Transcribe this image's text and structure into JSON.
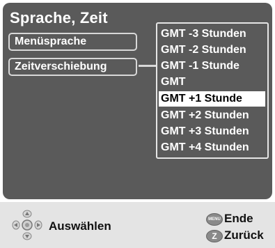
{
  "screen": {
    "title": "Sprache, Zeit",
    "menu": [
      {
        "label": "Menüsprache"
      },
      {
        "label": "Zeitverschiebung"
      }
    ]
  },
  "dropdown": {
    "options": [
      {
        "label": "GMT -3 Stunden"
      },
      {
        "label": "GMT -2 Stunden"
      },
      {
        "label": "GMT -1 Stunde"
      },
      {
        "label": "GMT"
      },
      {
        "label": "GMT +1 Stunde",
        "selected": true
      },
      {
        "label": "GMT +2 Stunden"
      },
      {
        "label": "GMT +3 Stunden"
      },
      {
        "label": "GMT +4 Stunden"
      }
    ]
  },
  "footer": {
    "select_label": "Auswählen",
    "menu_button_text": "MENU",
    "z_button_text": "Z",
    "end_label": "Ende",
    "back_label": "Zurück"
  },
  "colors": {
    "panel_bg": "#5a5a5a",
    "highlight_bg": "#ffffff",
    "footer_bg": "#e4e4e4"
  }
}
